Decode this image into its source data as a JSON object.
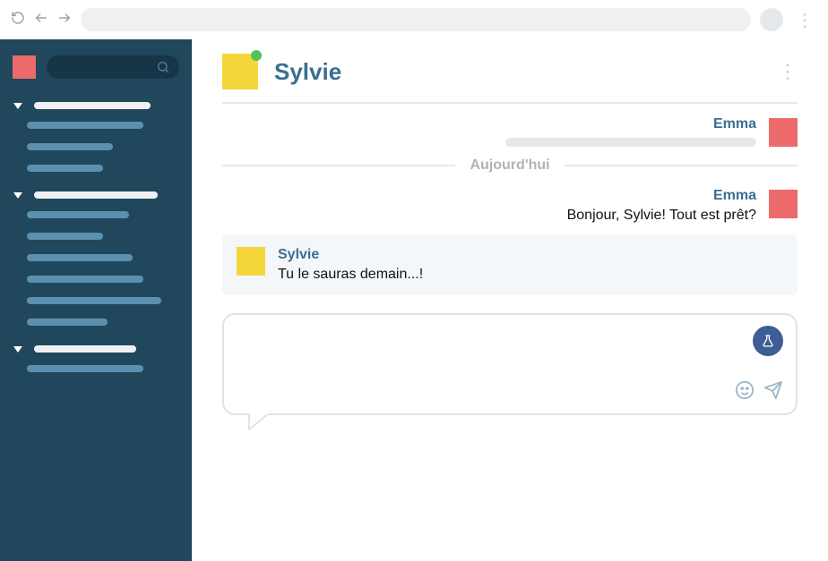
{
  "browser": {
    "address": ""
  },
  "chat": {
    "contact_name": "Sylvie",
    "presence": "online",
    "date_divider": "Aujourd'hui",
    "messages": [
      {
        "sender": "Emma",
        "text": "",
        "side": "right",
        "placeholder": true
      },
      {
        "sender": "Emma",
        "text": "Bonjour, Sylvie! Tout est prêt?",
        "side": "right"
      },
      {
        "sender": "Sylvie",
        "text": "Tu le sauras demain...!",
        "side": "left"
      }
    ]
  },
  "composer": {
    "placeholder": ""
  },
  "colors": {
    "sidebar_bg": "#20475b",
    "accent_yellow": "#f4d63b",
    "accent_red": "#ec6a6a",
    "accent_blue_text": "#3a6f91",
    "presence_green": "#56c05a",
    "lab_badge": "#3d5d93"
  }
}
